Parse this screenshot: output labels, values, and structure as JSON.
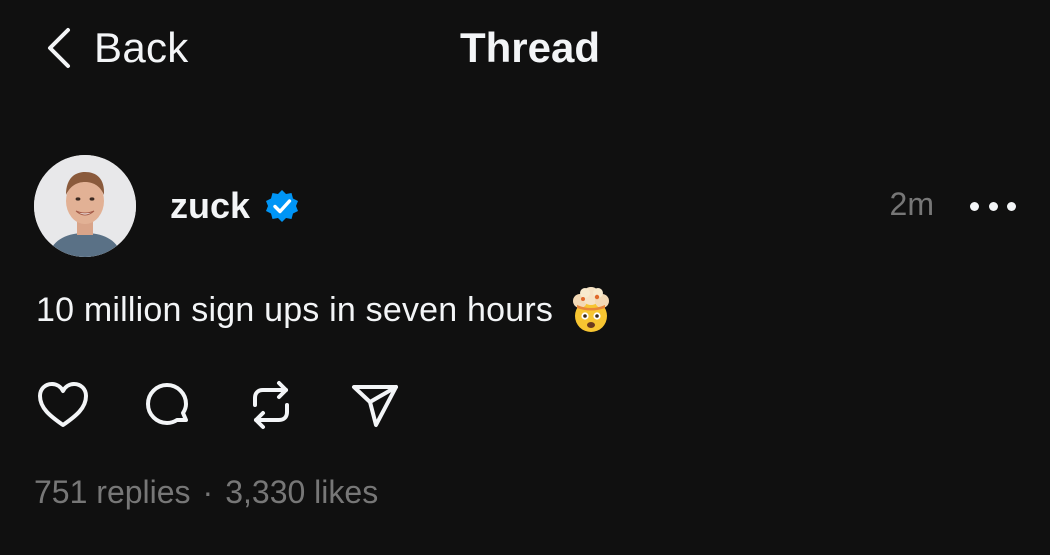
{
  "header": {
    "back_label": "Back",
    "title": "Thread"
  },
  "post": {
    "username": "zuck",
    "verified": true,
    "timestamp": "2m",
    "text": "10 million sign ups in seven hours",
    "emoji": "exploding-head-emoji"
  },
  "actions": [
    {
      "name": "like-button",
      "icon": "heart-icon"
    },
    {
      "name": "reply-button",
      "icon": "comment-icon"
    },
    {
      "name": "repost-button",
      "icon": "repost-icon"
    },
    {
      "name": "share-button",
      "icon": "send-icon"
    }
  ],
  "stats": {
    "replies": "751 replies",
    "separator": "·",
    "likes": "3,330 likes"
  },
  "colors": {
    "background": "#101010",
    "text": "#f3f5f7",
    "muted": "#777777",
    "verified_badge": "#0095f6"
  }
}
